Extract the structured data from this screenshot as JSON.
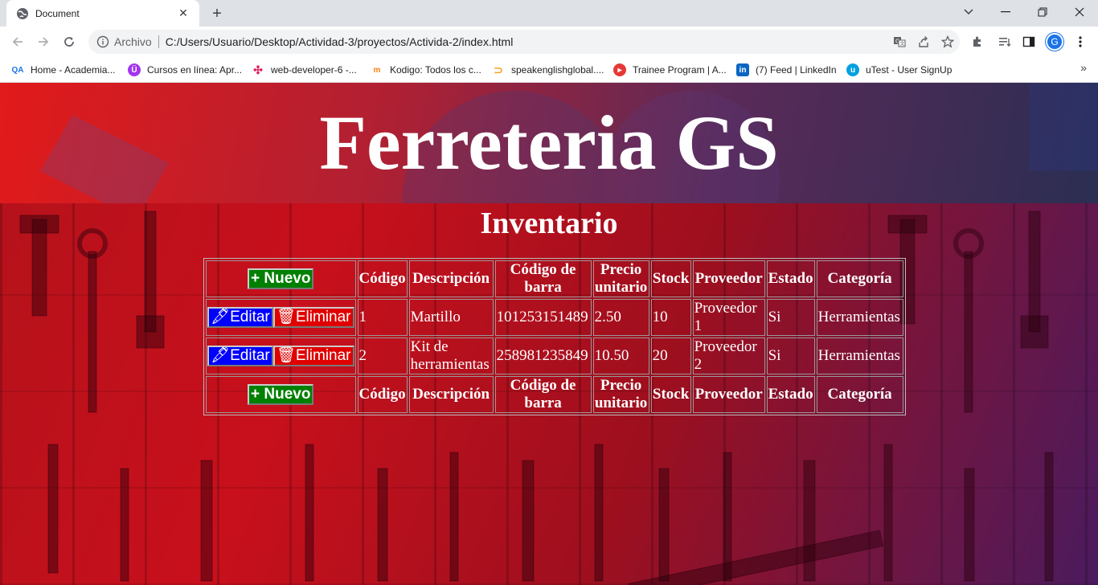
{
  "browser": {
    "tab_title": "Document",
    "scheme_label": "Archivo",
    "url": "C:/Users/Usuario/Desktop/Actividad-3/proyectos/Activida-2/index.html",
    "avatar_letter": "G"
  },
  "bookmarks": [
    {
      "label": "Home - Academia...",
      "icon": "qa-icon",
      "color": "#1a73e8"
    },
    {
      "label": "Cursos en línea: Apr...",
      "icon": "udemy-icon",
      "color": "#a435f0"
    },
    {
      "label": "web-developer-6 -...",
      "icon": "slack-icon",
      "color": "#e01e5a"
    },
    {
      "label": "Kodigo: Todos los c...",
      "icon": "moodle-icon",
      "color": "#f98012"
    },
    {
      "label": "speakenglishglobal....",
      "icon": "speak-icon",
      "color": "#f5a623"
    },
    {
      "label": "Trainee Program | A...",
      "icon": "trainee-icon",
      "color": "#e53935"
    },
    {
      "label": "(7) Feed | LinkedIn",
      "icon": "linkedin-icon",
      "color": "#0a66c2"
    },
    {
      "label": "uTest - User SignUp",
      "icon": "utest-icon",
      "color": "#00a1e0"
    }
  ],
  "page": {
    "site_title": "Ferreteria GS",
    "section_title": "Inventario",
    "new_button": "+ Nuevo",
    "edit_button": "🖋Editar",
    "delete_button": "🗑Eliminar",
    "columns": [
      "Código",
      "Descripción",
      "Código de barra",
      "Precio unitario",
      "Stock",
      "Proveedor",
      "Estado",
      "Categoría"
    ],
    "rows": [
      {
        "codigo": "1",
        "descripcion": "Martillo",
        "barra": "101253151489",
        "precio": "2.50",
        "stock": "10",
        "proveedor": "Proveedor 1",
        "estado": "Si",
        "categoria": "Herramientas"
      },
      {
        "codigo": "2",
        "descripcion": "Kit de herramientas",
        "barra": "258981235849",
        "precio": "10.50",
        "stock": "20",
        "proveedor": "Proveedor 2",
        "estado": "Si",
        "categoria": "Herramientas"
      }
    ]
  }
}
